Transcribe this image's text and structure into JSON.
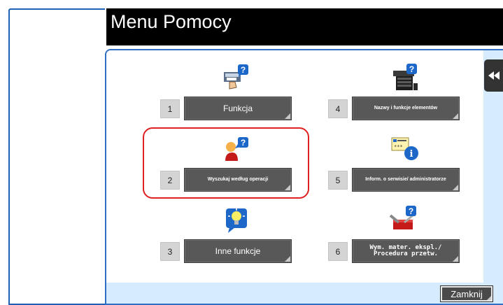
{
  "header": {
    "title": "Menu Pomocy"
  },
  "items": [
    {
      "number": "1",
      "label": "Funkcja"
    },
    {
      "number": "2",
      "label": "Wyszukaj według operacji"
    },
    {
      "number": "3",
      "label": "Inne funkcje"
    },
    {
      "number": "4",
      "label": "Nazwy i funkcje elementów"
    },
    {
      "number": "5",
      "label": "Inform. o serwisie/ administratorze"
    },
    {
      "number": "6",
      "label": "Wym. mater. ekspl./ Procedura przetw."
    }
  ],
  "footer": {
    "close_label": "Zamknij"
  },
  "colors": {
    "panel_border": "#2e6fc4",
    "panel_bg": "#d7ebff",
    "highlight": "#e02020",
    "button": "#585858"
  }
}
